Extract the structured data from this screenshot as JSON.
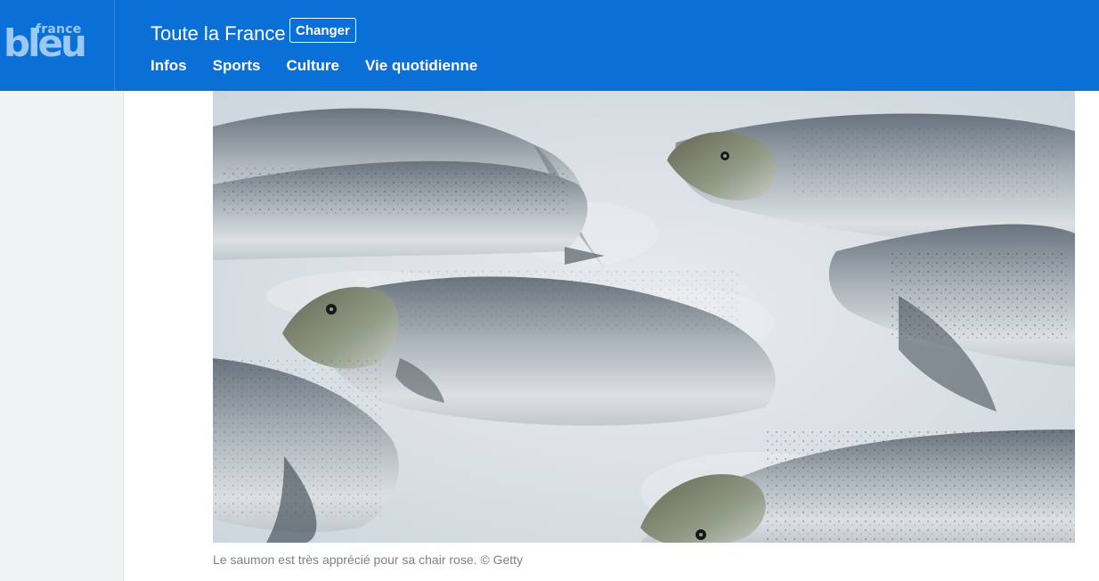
{
  "header": {
    "logo": {
      "small": "france",
      "big": "bleu"
    },
    "region": "Toute la France",
    "change_label": "Changer",
    "nav": [
      "Infos",
      "Sports",
      "Culture",
      "Vie quotidienne"
    ]
  },
  "article": {
    "image_subject": "salmon-on-ice",
    "caption": "Le saumon est très apprécié pour sa chair rose. © Getty"
  },
  "colors": {
    "header_bg": "#0b6fd8",
    "logo": "#9bc8f5",
    "rail_bg": "#f1f2f3",
    "caption": "#7b8087"
  }
}
